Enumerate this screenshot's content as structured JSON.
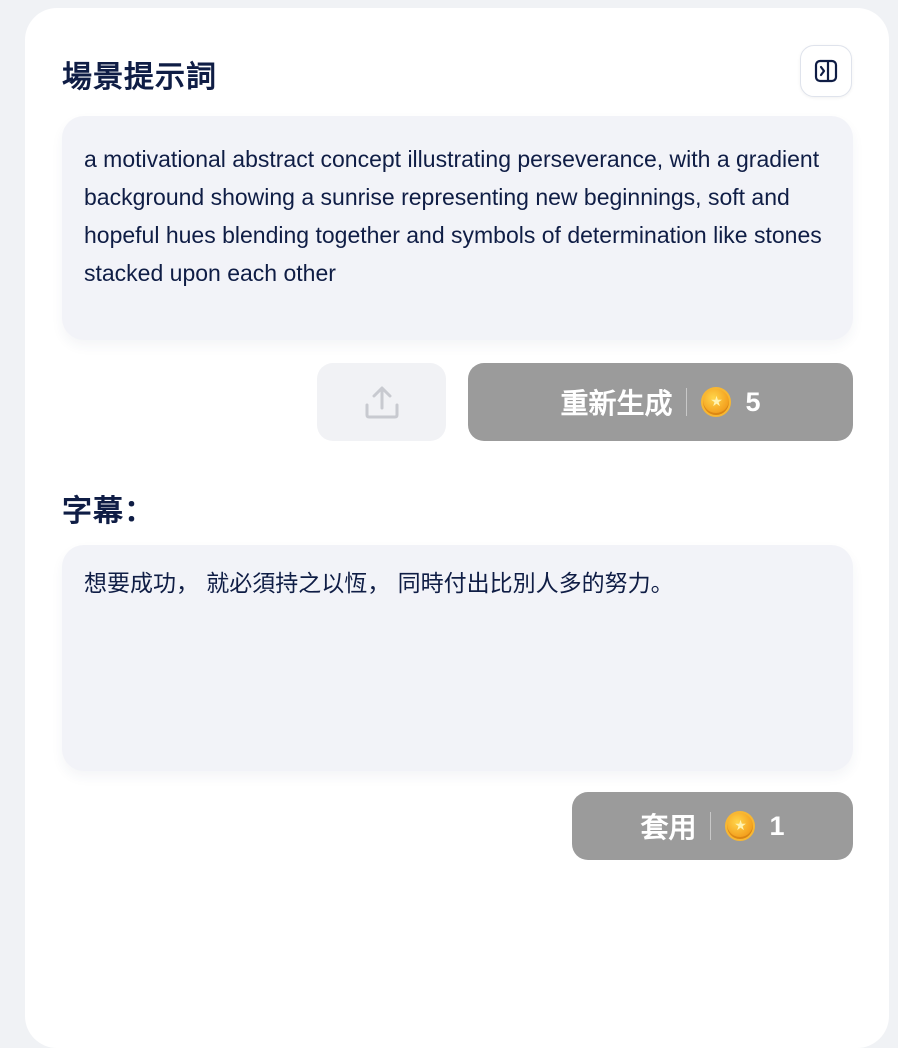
{
  "scene": {
    "title": "場景提示詞",
    "prompt": "a motivational abstract concept illustrating perseverance, with a gradient background showing a sunrise representing new beginnings, soft and hopeful hues blending together and symbols of determination like stones stacked upon each other",
    "regenerate_label": "重新生成",
    "regenerate_cost": "5"
  },
  "subtitle": {
    "title": "字幕：",
    "text": "想要成功， 就必須持之以恆， 同時付出比別人多的努力。",
    "apply_label": "套用",
    "apply_cost": "1"
  },
  "icons": {
    "toggle": "panel-toggle-icon",
    "upload": "upload-icon",
    "coin": "coin-icon"
  },
  "colors": {
    "title_text": "#0f1d45",
    "box_bg": "#f2f3f8",
    "button_gray": "#9b9b9b",
    "coin": "#f5a623"
  }
}
